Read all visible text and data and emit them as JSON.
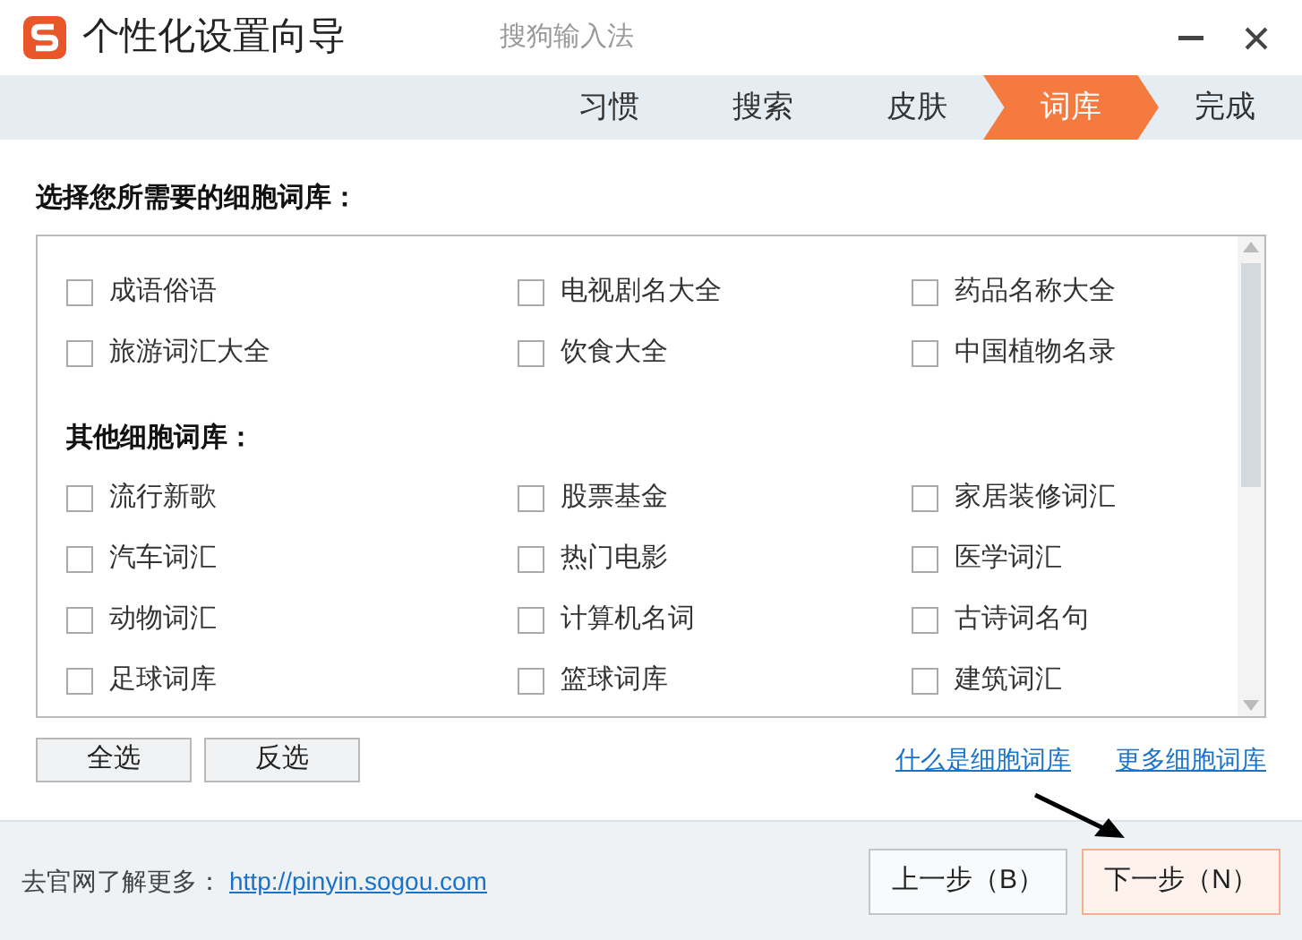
{
  "window": {
    "title": "个性化设置向导",
    "subtitle": "搜狗输入法"
  },
  "steps": [
    {
      "label": "习惯",
      "selected": false
    },
    {
      "label": "搜索",
      "selected": false
    },
    {
      "label": "皮肤",
      "selected": false
    },
    {
      "label": "词库",
      "selected": true
    },
    {
      "label": "完成",
      "selected": false
    }
  ],
  "prompt": "选择您所需要的细胞词库：",
  "groups": [
    {
      "items": [
        {
          "label": "成语俗语",
          "checked": false
        },
        {
          "label": "电视剧名大全",
          "checked": false
        },
        {
          "label": "药品名称大全",
          "checked": false
        },
        {
          "label": "旅游词汇大全",
          "checked": false
        },
        {
          "label": "饮食大全",
          "checked": false
        },
        {
          "label": "中国植物名录",
          "checked": false
        }
      ]
    },
    {
      "heading": "其他细胞词库：",
      "items": [
        {
          "label": "流行新歌",
          "checked": false
        },
        {
          "label": "股票基金",
          "checked": false
        },
        {
          "label": "家居装修词汇",
          "checked": false
        },
        {
          "label": "汽车词汇",
          "checked": false
        },
        {
          "label": "热门电影",
          "checked": false
        },
        {
          "label": "医学词汇",
          "checked": false
        },
        {
          "label": "动物词汇",
          "checked": false
        },
        {
          "label": "计算机名词",
          "checked": false
        },
        {
          "label": "古诗词名句",
          "checked": false
        },
        {
          "label": "足球词库",
          "checked": false
        },
        {
          "label": "篮球词库",
          "checked": false
        },
        {
          "label": "建筑词汇",
          "checked": false
        }
      ]
    }
  ],
  "select_buttons": [
    "全选",
    "反选"
  ],
  "links": [
    "什么是细胞词库",
    "更多细胞词库"
  ],
  "footer": {
    "text": "去官网了解更多：",
    "link": "http://pinyin.sogou.com"
  },
  "nav_buttons": [
    {
      "label": "上一步（B）",
      "selected": false
    },
    {
      "label": "下一步（N）",
      "selected": true
    }
  ]
}
